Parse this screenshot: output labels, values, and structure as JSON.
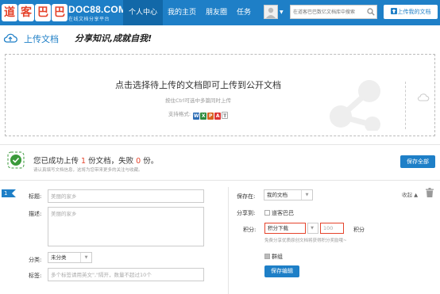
{
  "header": {
    "logo_chars": [
      "道",
      "客",
      "巴",
      "巴"
    ],
    "brand_en": "DOC88.COM",
    "brand_sub": "在线文档分享平台",
    "nav": [
      {
        "label": "个人中心",
        "active": true
      },
      {
        "label": "我的主页",
        "active": false
      },
      {
        "label": "朋友圈",
        "active": false
      },
      {
        "label": "任务",
        "active": false
      }
    ],
    "search_placeholder": "在道客巴巴数亿文档库中搜索",
    "upload_button": "上传我的文档",
    "accent_color": "#1e7fc7"
  },
  "page": {
    "title": "上传文档",
    "slogan": "分享知识,成就自我!"
  },
  "dropzone": {
    "main_text": "点击选择待上传的文档即可上传到公开文档",
    "hint": "按住Ctrl可选中多篇同时上传",
    "formats_label": "支持格式:"
  },
  "status": {
    "prefix": "您已成功上传",
    "success_count": "1",
    "mid": "份文档，失败",
    "fail_count": "0",
    "suffix": "份。",
    "sub": "请认真填写文档信息，这将为您带来更多的关注与收藏。",
    "save_all": "保存全部"
  },
  "form": {
    "index": "1",
    "title_label": "标题:",
    "title_value": "美丽的家乡",
    "desc_label": "描述:",
    "desc_value": "美丽的家乡",
    "category_label": "分类:",
    "category_value": "未分类",
    "tags_label": "标签:",
    "tags_placeholder": "多个标签请用英文\",\"隔开，数量不超过10个",
    "save_in_label": "保存在:",
    "save_in_value": "我的文档",
    "share_label": "分享到:",
    "share_target": "道客巴巴",
    "points_label": "积分:",
    "points_type": "积分下载",
    "points_value": "100",
    "points_unit": "积分",
    "points_hint": "免费分享优质原创文档将获得积分奖励哦~",
    "group_label": "群组",
    "save_edit": "保存编辑",
    "collapse": "收起"
  }
}
